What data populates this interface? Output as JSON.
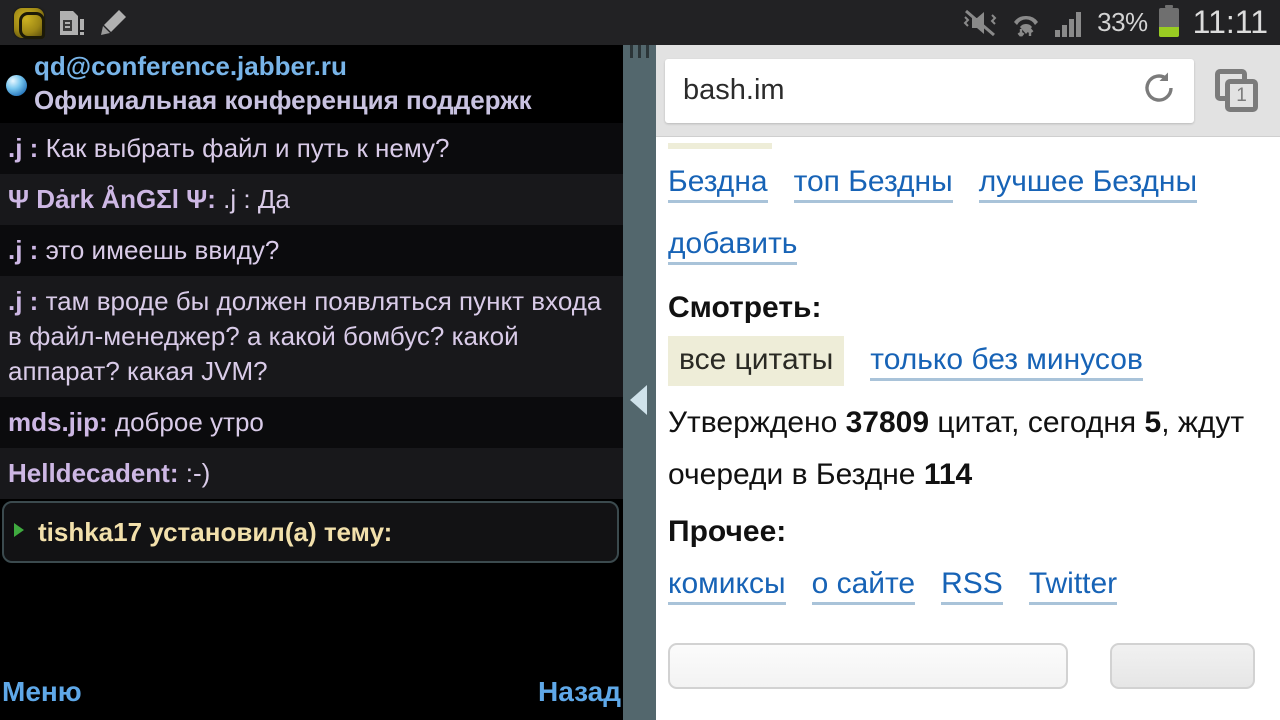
{
  "statusbar": {
    "icons_left": [
      "jabber-app-icon",
      "sim-card-alert-icon",
      "pencil-edit-icon"
    ],
    "icons_right": [
      "mute-vibrate-icon",
      "wifi-icon",
      "signal-bars-icon",
      "battery-icon"
    ],
    "battery_percent": "33%",
    "clock": "11:11"
  },
  "chat": {
    "jid": "qd@conference.jabber.ru",
    "subject": "Официальная конференция поддержк",
    "messages": [
      {
        "nick": ".j",
        "sep": " : ",
        "body": "Как выбрать файл и путь к нему?"
      },
      {
        "nick": "Ψ Dȧrk ÅnGΣl Ψ",
        "sep": ": ",
        "body": ".j : Да"
      },
      {
        "nick": ".j",
        "sep": " : ",
        "body": "это имеешь ввиду?"
      },
      {
        "nick": ".j",
        "sep": " : ",
        "body": "там вроде бы должен появляться пункт входа в файл-менеджер? а какой бомбус? какой аппарат? какая JVM?"
      },
      {
        "nick": "mds.jip",
        "sep": ": ",
        "body": "доброе утро"
      },
      {
        "nick": "Helldecadent",
        "sep": ": ",
        "body": ":-)"
      }
    ],
    "selected_message": "tishka17 установил(а) тему:",
    "softkey_left": "Меню",
    "softkey_right": "Назад"
  },
  "divider": {
    "handle_icon": "collapse-left-arrow-icon"
  },
  "browser": {
    "url": "bash.im",
    "reload_icon": "reload-icon",
    "tabs_icon": "tabs-icon",
    "tab_count": "1",
    "nav_links": [
      "Бездна",
      "топ Бездны",
      "лучшее Бездны"
    ],
    "add_link": "добавить",
    "watch_heading": "Смотреть:",
    "watch_active": "все цитаты",
    "watch_link": "только без минусов",
    "stats": {
      "prefix": "Утверждено ",
      "approved": "37809",
      "mid1": " цитат, сегодня ",
      "today": "5",
      "mid2": ", ждут очереди в Бездне ",
      "pending": "114"
    },
    "other_heading": "Прочее:",
    "other_links": [
      "комиксы",
      "о сайте",
      "RSS",
      "Twitter"
    ]
  },
  "colors": {
    "link": "#1763b6",
    "chat_nick": "#cdb7e4",
    "selected_text": "#f2e0ab",
    "divider": "#53676d",
    "highlight_pill": "#eeedd8",
    "battery_green": "#99cc22"
  }
}
